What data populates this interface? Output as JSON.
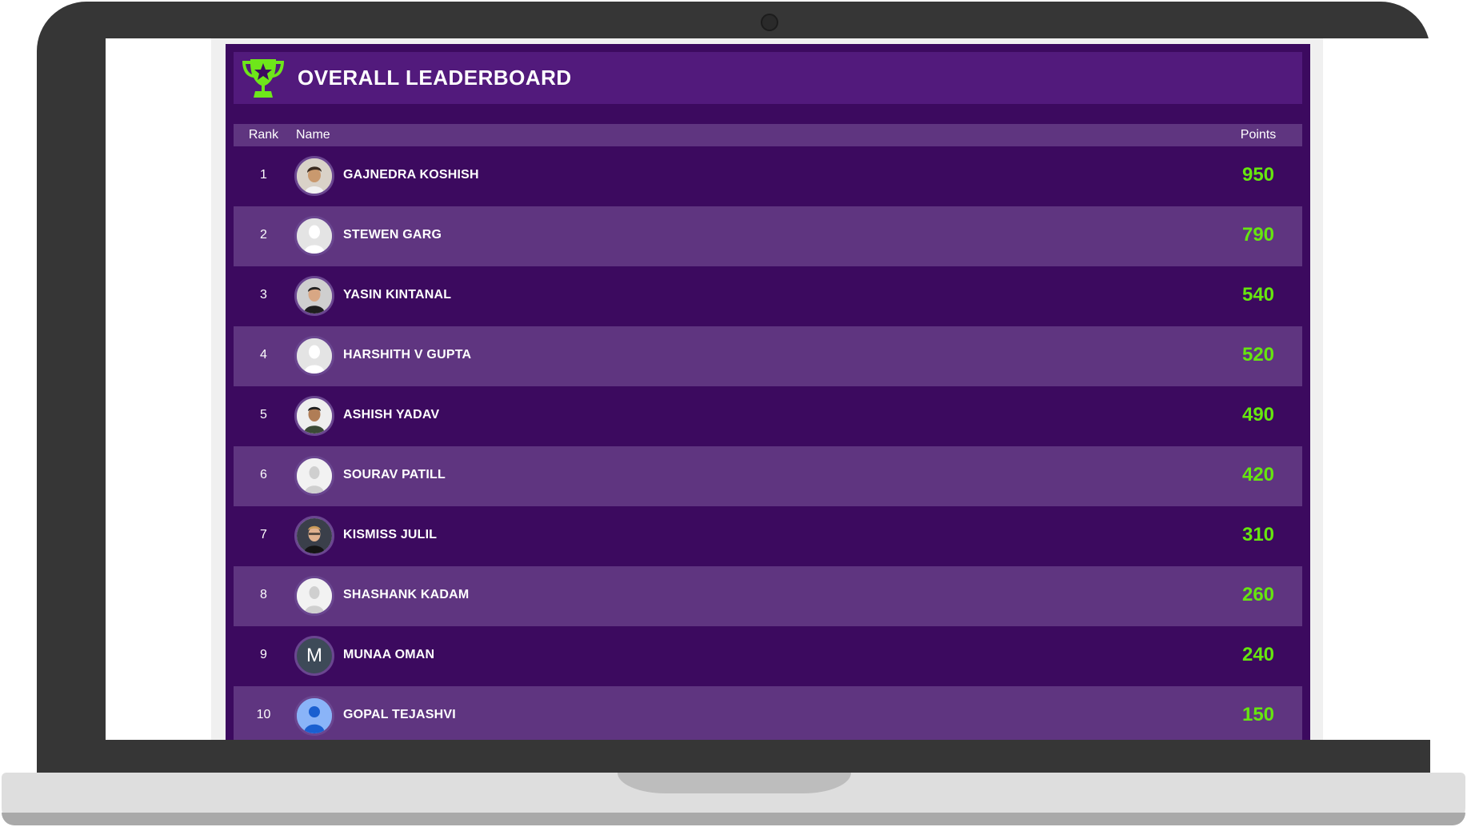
{
  "leaderboard": {
    "title": "OVERALL LEADERBOARD",
    "trophy_icon": "trophy-star-icon",
    "columns": {
      "rank": "Rank",
      "name": "Name",
      "points": "Points"
    },
    "rows": [
      {
        "rank": "1",
        "name": "GAJNEDRA KOSHISH",
        "points": "950",
        "avatar": "photo"
      },
      {
        "rank": "2",
        "name": "STEWEN GARG",
        "points": "790",
        "avatar": "silhouette-placeholder"
      },
      {
        "rank": "3",
        "name": "YASIN KINTANAL",
        "points": "540",
        "avatar": "photo"
      },
      {
        "rank": "4",
        "name": "HARSHITH V GUPTA",
        "points": "520",
        "avatar": "silhouette-placeholder"
      },
      {
        "rank": "5",
        "name": "ASHISH YADAV",
        "points": "490",
        "avatar": "photo"
      },
      {
        "rank": "6",
        "name": "SOURAV PATILL",
        "points": "420",
        "avatar": "grey-placeholder"
      },
      {
        "rank": "7",
        "name": "KISMISS JULIL",
        "points": "310",
        "avatar": "photo"
      },
      {
        "rank": "8",
        "name": "SHASHANK KADAM",
        "points": "260",
        "avatar": "grey-placeholder"
      },
      {
        "rank": "9",
        "name": "MUNAA OMAN",
        "points": "240",
        "avatar": "initial",
        "initial": "M"
      },
      {
        "rank": "10",
        "name": "GOPAL TEJASHVI",
        "points": "150",
        "avatar": "blue-placeholder"
      }
    ]
  },
  "colors": {
    "board_bg": "#3c0a5f",
    "header_bg": "#521a7c",
    "alt_row_bg": "#5f3580",
    "points": "#66e60f",
    "trophy": "#6ee61a"
  }
}
